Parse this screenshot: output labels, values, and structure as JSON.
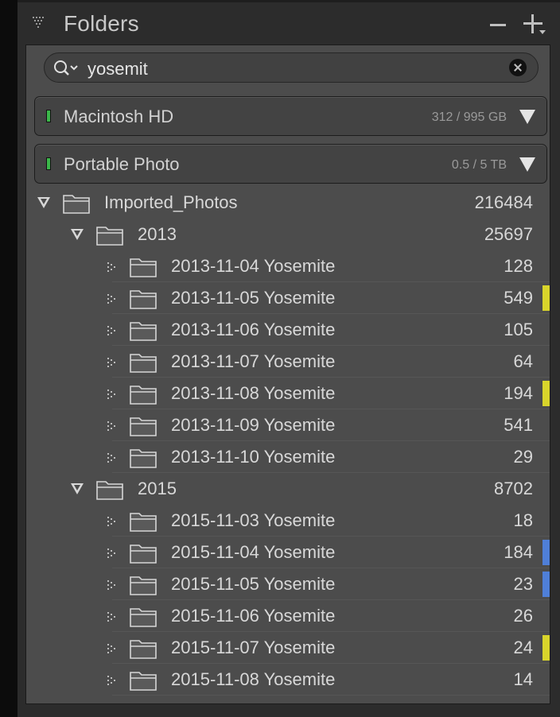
{
  "panel": {
    "title": "Folders"
  },
  "search": {
    "value": "yosemit"
  },
  "volumes": [
    {
      "name": "Macintosh HD",
      "usage": "312 / 995 GB",
      "status_color": "#3bb84a"
    },
    {
      "name": "Portable Photo",
      "usage": "0.5 / 5 TB",
      "status_color": "#3bb84a"
    }
  ],
  "tree": {
    "root": {
      "name": "Imported_Photos",
      "count": "216484"
    },
    "years": [
      {
        "name": "2013",
        "count": "25697",
        "folders": [
          {
            "name": "2013-11-04 Yosemite",
            "count": "128",
            "label_color": ""
          },
          {
            "name": "2013-11-05 Yosemite",
            "count": "549",
            "label_color": "#d9d52b"
          },
          {
            "name": "2013-11-06 Yosemite",
            "count": "105",
            "label_color": ""
          },
          {
            "name": "2013-11-07 Yosemite",
            "count": "64",
            "label_color": ""
          },
          {
            "name": "2013-11-08 Yosemite",
            "count": "194",
            "label_color": "#d9d52b"
          },
          {
            "name": "2013-11-09 Yosemite",
            "count": "541",
            "label_color": ""
          },
          {
            "name": "2013-11-10 Yosemite",
            "count": "29",
            "label_color": ""
          }
        ]
      },
      {
        "name": "2015",
        "count": "8702",
        "folders": [
          {
            "name": "2015-11-03 Yosemite",
            "count": "18",
            "label_color": ""
          },
          {
            "name": "2015-11-04 Yosemite",
            "count": "184",
            "label_color": "#4f7fd8"
          },
          {
            "name": "2015-11-05 Yosemite",
            "count": "23",
            "label_color": "#4f7fd8"
          },
          {
            "name": "2015-11-06 Yosemite",
            "count": "26",
            "label_color": ""
          },
          {
            "name": "2015-11-07 Yosemite",
            "count": "24",
            "label_color": "#d9d52b"
          },
          {
            "name": "2015-11-08 Yosemite",
            "count": "14",
            "label_color": ""
          }
        ]
      }
    ]
  }
}
